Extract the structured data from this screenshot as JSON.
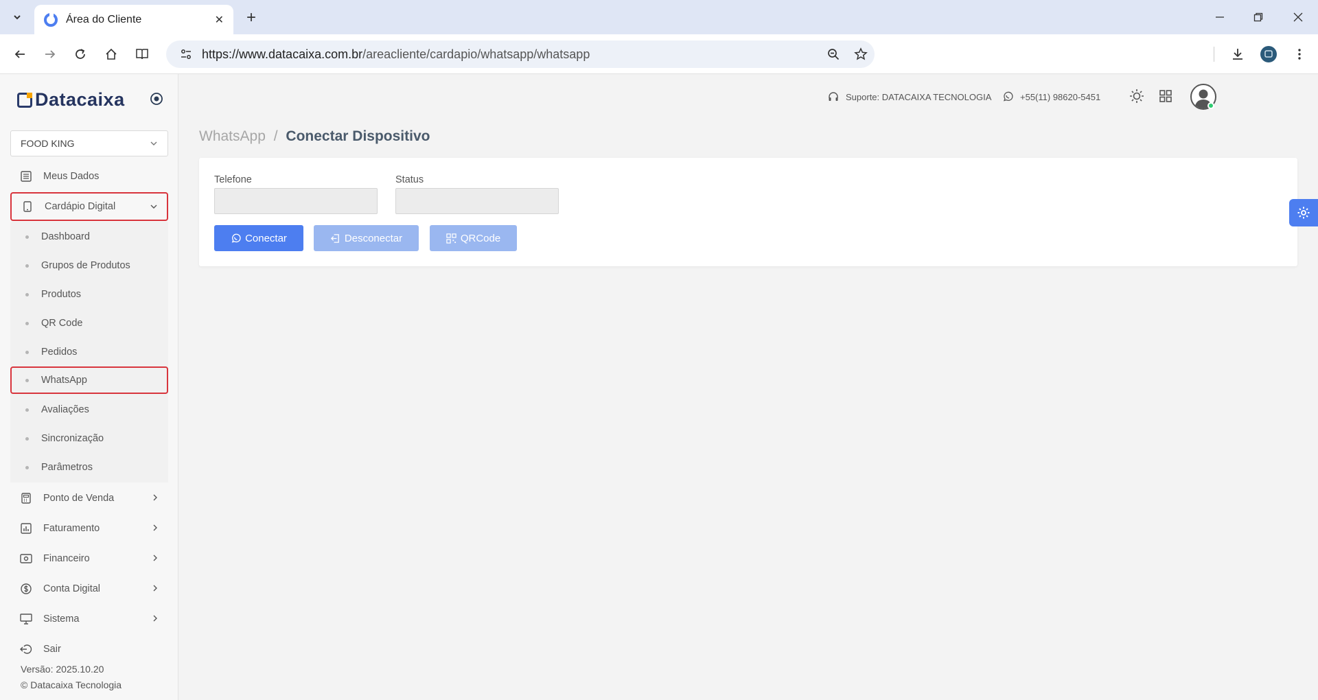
{
  "browser": {
    "tab_title": "Área do Cliente",
    "url_host": "https://www.datacaixa.com.br",
    "url_path": "/areacliente/cardapio/whatsapp/whatsapp"
  },
  "sidebar": {
    "brand": "Datacaixa",
    "company": "FOOD KING",
    "menu": [
      {
        "label": "Meus Dados"
      },
      {
        "label": "Cardápio Digital"
      },
      {
        "label": "Ponto de Venda"
      },
      {
        "label": "Faturamento"
      },
      {
        "label": "Financeiro"
      },
      {
        "label": "Conta Digital"
      },
      {
        "label": "Sistema"
      },
      {
        "label": "Sair"
      }
    ],
    "submenu": [
      {
        "label": "Dashboard"
      },
      {
        "label": "Grupos de Produtos"
      },
      {
        "label": "Produtos"
      },
      {
        "label": "QR Code"
      },
      {
        "label": "Pedidos"
      },
      {
        "label": "WhatsApp"
      },
      {
        "label": "Avaliações"
      },
      {
        "label": "Sincronização"
      },
      {
        "label": "Parâmetros"
      }
    ],
    "version": "Versão: 2025.10.20",
    "copyright": "© Datacaixa Tecnologia"
  },
  "header": {
    "support": "Suporte: DATACAIXA TECNOLOGIA",
    "phone": "+55(11) 98620-5451"
  },
  "main": {
    "breadcrumb_parent": "WhatsApp",
    "breadcrumb_sep": "/",
    "breadcrumb_current": "Conectar Dispositivo",
    "phone_label": "Telefone",
    "phone_value": "",
    "status_label": "Status",
    "status_value": "",
    "connect_label": "Conectar",
    "disconnect_label": "Desconectar",
    "qrcode_label": "QRCode"
  },
  "colors": {
    "primary": "#4d7ef0",
    "primary_disabled": "#9ab7f0",
    "highlight": "#d8343c",
    "brand": "#25345f",
    "online": "#2ecc71"
  }
}
